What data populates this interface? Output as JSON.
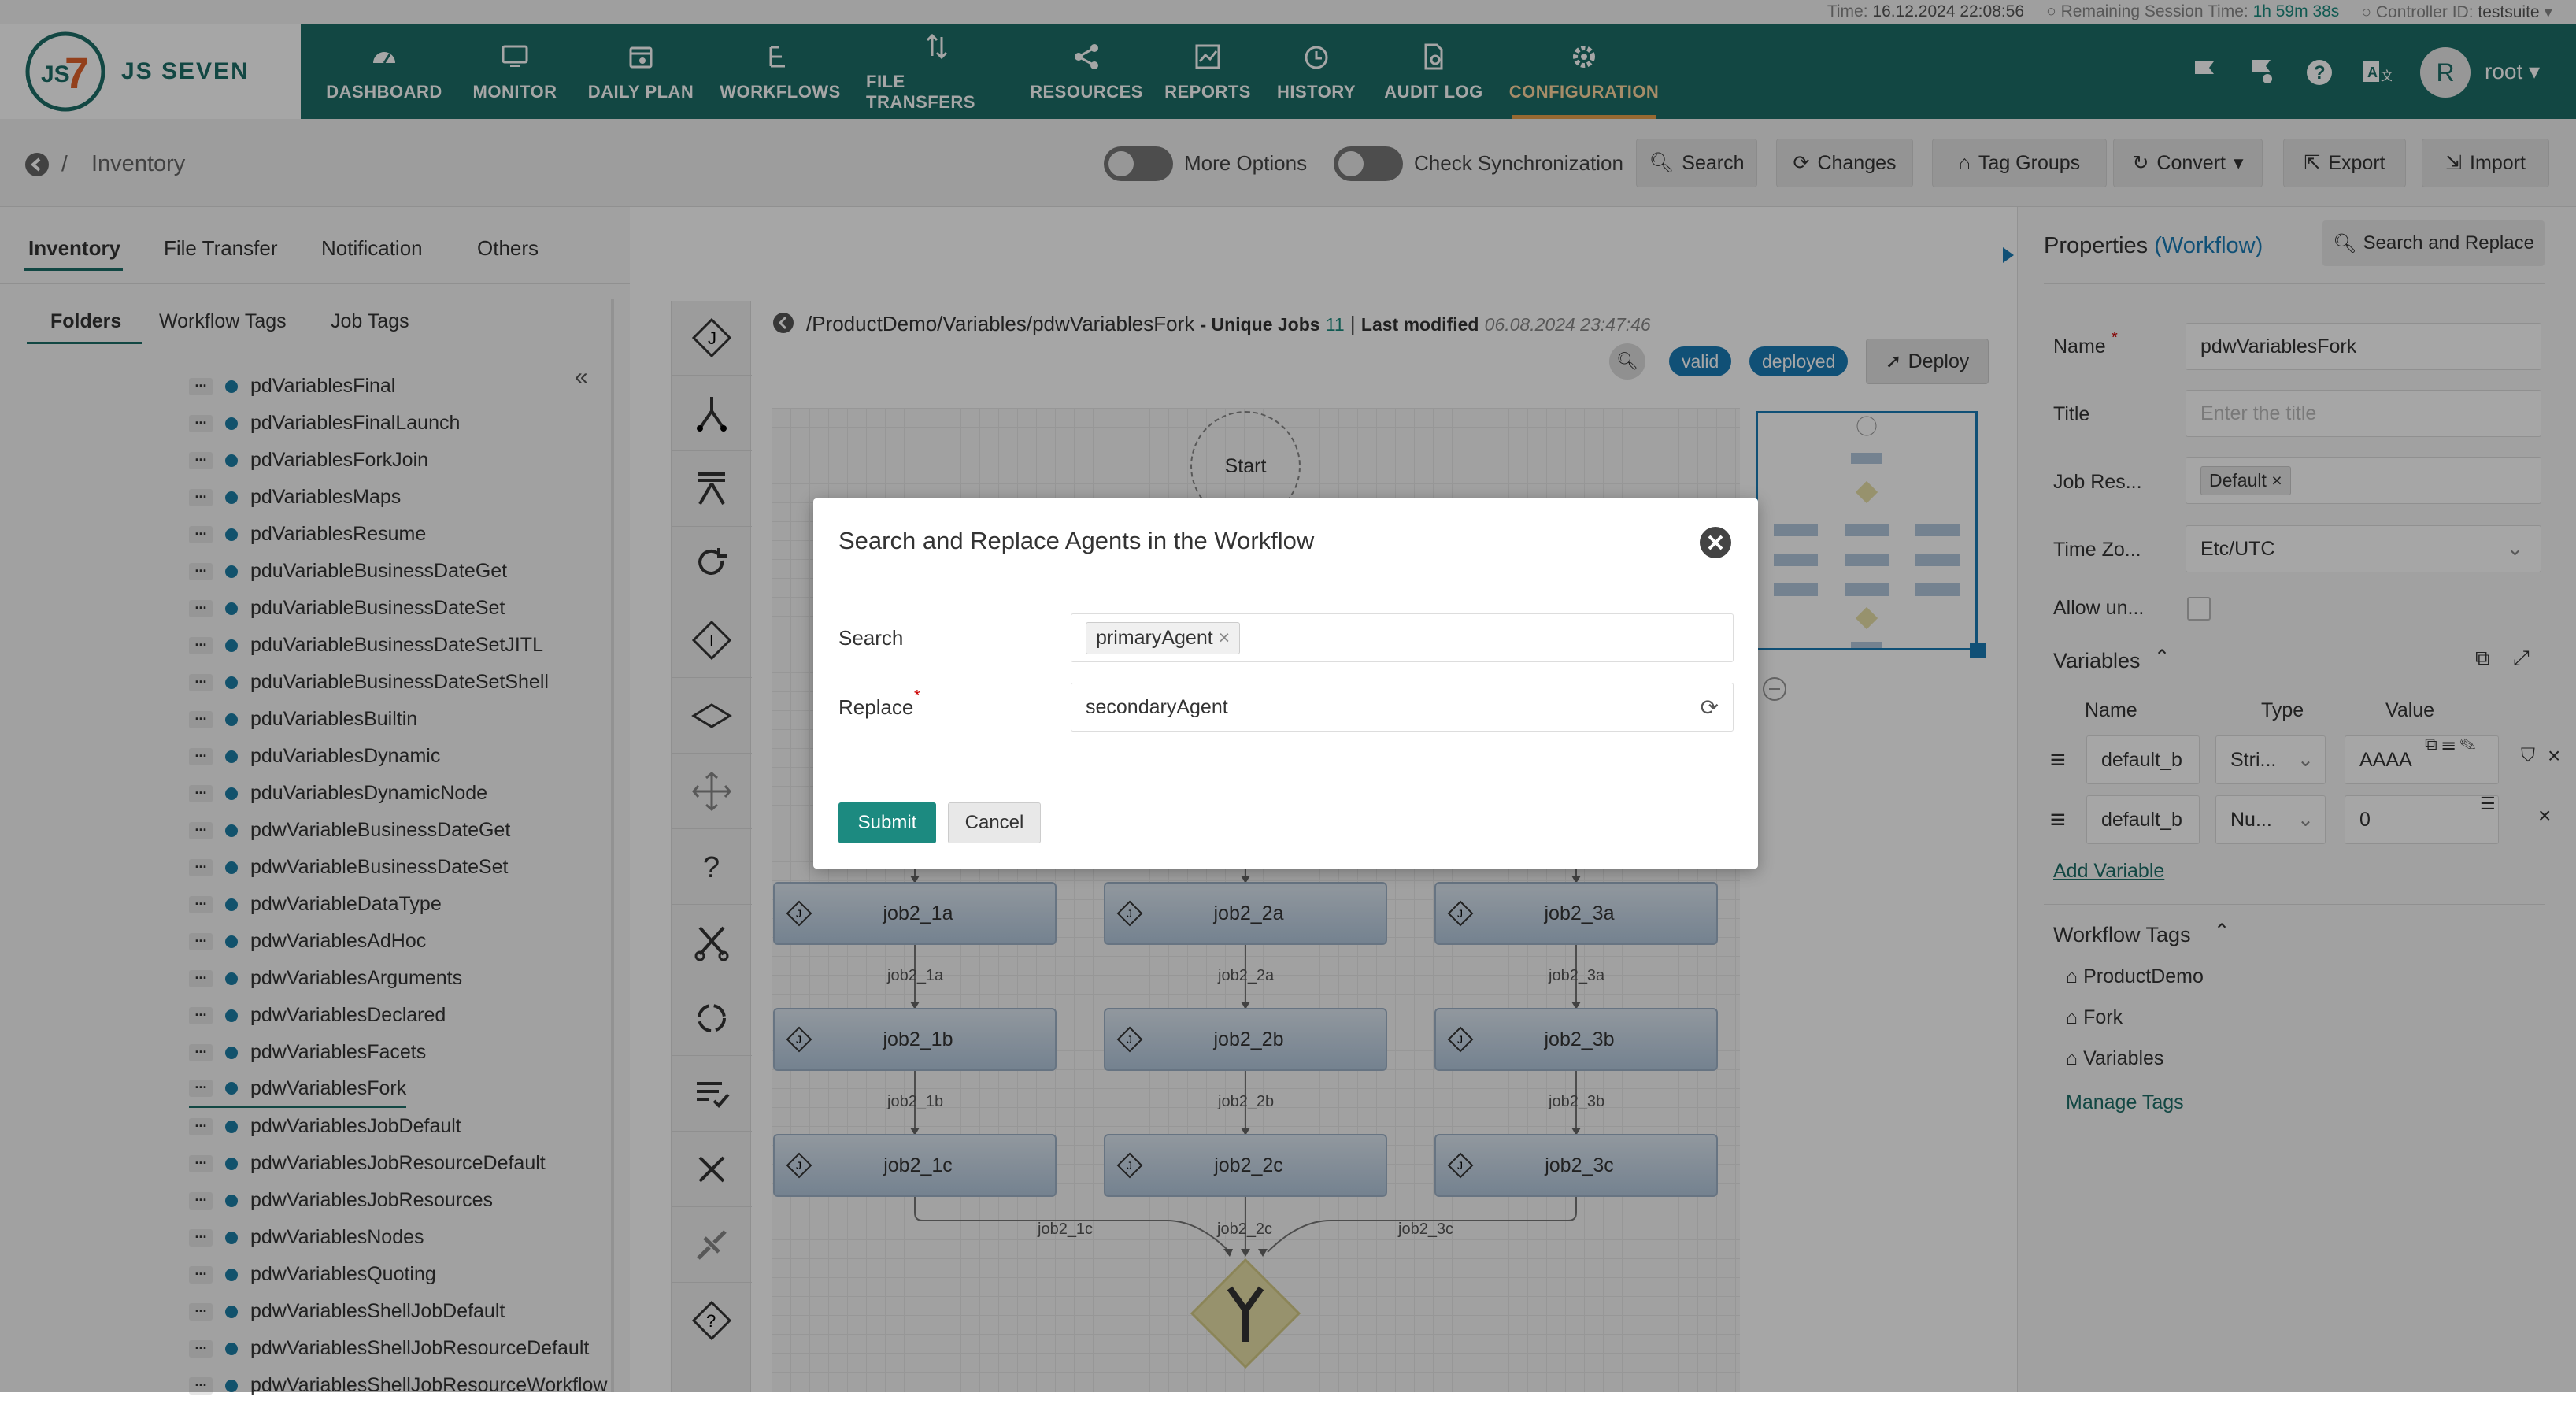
{
  "topinfo": {
    "time_label": "Time:",
    "time_value": "16.12.2024 22:08:56",
    "session_label": "Remaining Session Time:",
    "session_value": "1h 59m 38s",
    "controller_label": "Controller ID:",
    "controller_value": "testsuite"
  },
  "brand": {
    "name": "JS SEVEN"
  },
  "nav": [
    {
      "label": "DASHBOARD",
      "icon": "dashboard-icon"
    },
    {
      "label": "MONITOR",
      "icon": "monitor-icon"
    },
    {
      "label": "DAILY PLAN",
      "icon": "calendar-icon"
    },
    {
      "label": "WORKFLOWS",
      "icon": "workflow-icon"
    },
    {
      "label": "FILE TRANSFERS",
      "icon": "transfer-icon"
    },
    {
      "label": "RESOURCES",
      "icon": "share-icon"
    },
    {
      "label": "REPORTS",
      "icon": "chart-icon"
    },
    {
      "label": "HISTORY",
      "icon": "clock-icon"
    },
    {
      "label": "AUDIT LOG",
      "icon": "audit-icon"
    },
    {
      "label": "CONFIGURATION",
      "icon": "gear-icon"
    }
  ],
  "user": {
    "initial": "R",
    "name": "root"
  },
  "breadcrumb": {
    "sep": "/",
    "title": "Inventory"
  },
  "subbar": {
    "more_options": "More Options",
    "check_sync": "Check Synchronization",
    "buttons": [
      "Search",
      "Changes",
      "Tag Groups",
      "Convert",
      "Export",
      "Import"
    ]
  },
  "left": {
    "tabs": [
      "Inventory",
      "File Transfer",
      "Notification",
      "Others"
    ],
    "subtabs": [
      "Folders",
      "Workflow Tags",
      "Job Tags"
    ],
    "tree": [
      "pdVariablesFinal",
      "pdVariablesFinalLaunch",
      "pdVariablesForkJoin",
      "pdVariablesMaps",
      "pdVariablesResume",
      "pduVariableBusinessDateGet",
      "pduVariableBusinessDateSet",
      "pduVariableBusinessDateSetJITL",
      "pduVariableBusinessDateSetShell",
      "pduVariablesBuiltin",
      "pduVariablesDynamic",
      "pduVariablesDynamicNode",
      "pdwVariableBusinessDateGet",
      "pdwVariableBusinessDateSet",
      "pdwVariableDataType",
      "pdwVariablesAdHoc",
      "pdwVariablesArguments",
      "pdwVariablesDeclared",
      "pdwVariablesFacets",
      "pdwVariablesFork",
      "pdwVariablesJobDefault",
      "pdwVariablesJobResourceDefault",
      "pdwVariablesJobResources",
      "pdwVariablesNodes",
      "pdwVariablesQuoting",
      "pdwVariablesShellJobDefault",
      "pdwVariablesShellJobResourceDefault",
      "pdwVariablesShellJobResourceWorkflow"
    ]
  },
  "workflow": {
    "path": "/ProductDemo/Variables/pdwVariablesFork",
    "unique_label": "- Unique Jobs",
    "unique_count": "11",
    "sep": "|",
    "modified_label": "Last modified",
    "modified_value": "06.08.2024 23:47:46",
    "status_valid": "valid",
    "status_deployed": "deployed",
    "deploy": "Deploy",
    "start": "Start",
    "jobs": [
      [
        "job2_1a",
        "job2_2a",
        "job2_3a"
      ],
      [
        "job2_1b",
        "job2_2b",
        "job2_3b"
      ],
      [
        "job2_1c",
        "job2_2c",
        "job2_3c"
      ]
    ]
  },
  "properties": {
    "title": "Properties",
    "type": "(Workflow)",
    "search_replace": "Search and Replace",
    "name_label": "Name",
    "name_value": "pdwVariablesFork",
    "title_label": "Title",
    "title_placeholder": "Enter the title",
    "jobres_label": "Job Res...",
    "jobres_tag": "Default",
    "tz_label": "Time Zo...",
    "tz_value": "Etc/UTC",
    "allow_label": "Allow un...",
    "variables_label": "Variables",
    "col_name": "Name",
    "col_type": "Type",
    "col_value": "Value",
    "vars": [
      {
        "name": "default_b",
        "type": "Stri...",
        "value": "AAAA"
      },
      {
        "name": "default_b",
        "type": "Nu...",
        "value": "0"
      }
    ],
    "add_variable": "Add Variable",
    "tags_label": "Workflow Tags",
    "tags": [
      "ProductDemo",
      "Fork",
      "Variables"
    ],
    "manage_tags": "Manage Tags"
  },
  "modal": {
    "title": "Search and Replace Agents in the Workflow",
    "search_label": "Search",
    "search_tag": "primaryAgent",
    "replace_label": "Replace",
    "replace_value": "secondaryAgent",
    "submit": "Submit",
    "cancel": "Cancel"
  },
  "colors": {
    "nav": "#1c6e67",
    "accent": "#1b8a7e",
    "badge": "#1a7bb5"
  }
}
